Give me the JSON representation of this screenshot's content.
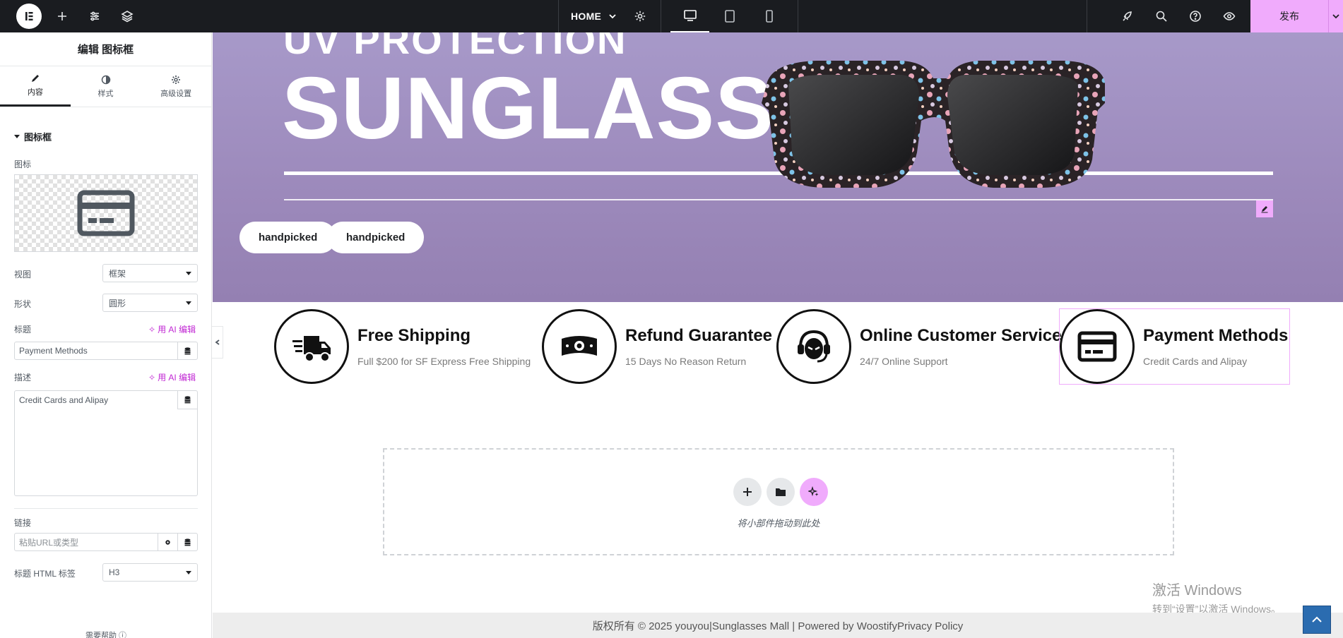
{
  "topbar": {
    "home_label": "HOME",
    "publish_label": "发布"
  },
  "panel": {
    "title": "编辑 图标框",
    "tabs": [
      {
        "label": "内容"
      },
      {
        "label": "样式"
      },
      {
        "label": "高级设置"
      }
    ],
    "section_title": "图标框",
    "icon_label": "图标",
    "view_label": "视图",
    "view_value": "框架",
    "shape_label": "形状",
    "shape_value": "圆形",
    "title_label": "标题",
    "ai_edit_label": "用 AI 编辑",
    "title_value": "Payment Methods",
    "desc_label": "描述",
    "desc_value": "Credit Cards and Alipay",
    "link_label": "链接",
    "link_placeholder": "粘贴URL或类型",
    "html_tag_label": "标题 HTML 标签",
    "html_tag_value": "H3",
    "help_label": "需要帮助"
  },
  "hero": {
    "subtitle": "UV PROTECTION",
    "title": "SUNGLASSES",
    "buttons": [
      "handpicked",
      "handpicked"
    ]
  },
  "features": [
    {
      "title": "Free Shipping",
      "desc": "Full $200 for SF Express Free Shipping",
      "icon": "delivery-truck-icon"
    },
    {
      "title": "Refund Guarantee",
      "desc": "15 Days No Reason Return",
      "icon": "money-bill-icon"
    },
    {
      "title": "Online Customer Service",
      "desc": "24/7 Online Support",
      "icon": "headset-icon"
    },
    {
      "title": "Payment Methods",
      "desc": "Credit Cards and Alipay",
      "icon": "credit-card-icon"
    }
  ],
  "dropzone": {
    "text": "将小部件拖动到此处"
  },
  "watermark": {
    "line1": "激活 Windows",
    "line2": "转到“设置”以激活 Windows。"
  },
  "footer": {
    "text": "版权所有 © 2025 youyou|Sunglasses Mall | Powered by WoostifyPrivacy Policy"
  },
  "colors": {
    "accent": "#f0abfc",
    "topbar": "#1a1c20",
    "hero_bg": "#a799c9"
  }
}
